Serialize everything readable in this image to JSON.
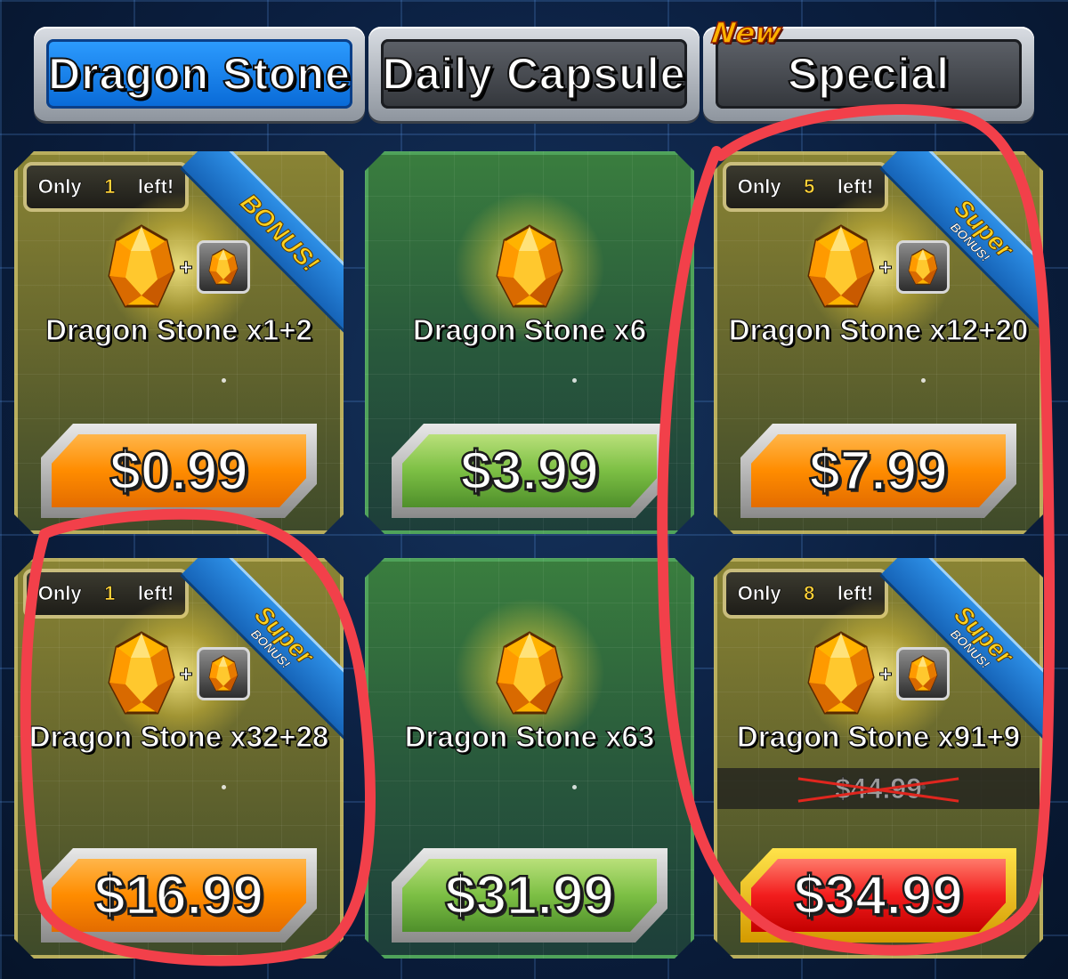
{
  "tabs": [
    {
      "label": "Dragon Stone",
      "active": true
    },
    {
      "label": "Daily Capsule",
      "active": false
    },
    {
      "label": "Special",
      "active": false,
      "badge": "New"
    }
  ],
  "only_text": {
    "prefix": "Only",
    "suffix": "left!"
  },
  "cards": [
    {
      "title": "Dragon Stone x1+2",
      "price": "$0.99",
      "style": "gold",
      "only_left": "1",
      "ribbon": "BONUS!",
      "ribbon_sub": "",
      "bonus_icon": true
    },
    {
      "title": "Dragon Stone x6",
      "price": "$3.99",
      "style": "green",
      "only_left": null,
      "ribbon": null,
      "bonus_icon": false
    },
    {
      "title": "Dragon Stone x12+20",
      "price": "$7.99",
      "style": "gold",
      "only_left": "5",
      "ribbon": "Super",
      "ribbon_sub": "BONUS!",
      "bonus_icon": true
    },
    {
      "title": "Dragon Stone x32+28",
      "price": "$16.99",
      "style": "gold",
      "only_left": "1",
      "ribbon": "Super",
      "ribbon_sub": "BONUS!",
      "bonus_icon": true
    },
    {
      "title": "Dragon Stone x63",
      "price": "$31.99",
      "style": "green",
      "only_left": null,
      "ribbon": null,
      "bonus_icon": false
    },
    {
      "title": "Dragon Stone x91+9",
      "price": "$34.99",
      "style": "gold",
      "only_left": "8",
      "ribbon": "Super",
      "ribbon_sub": "BONUS!",
      "bonus_icon": true,
      "old_price": "$44.99",
      "sale": true
    }
  ],
  "colors": {
    "annotation": "#f2404a",
    "tab_active": "#1a84f0",
    "gem": "#ffb300"
  },
  "icons": {
    "gem": "dragon-stone-icon",
    "plus": "plus-icon"
  }
}
